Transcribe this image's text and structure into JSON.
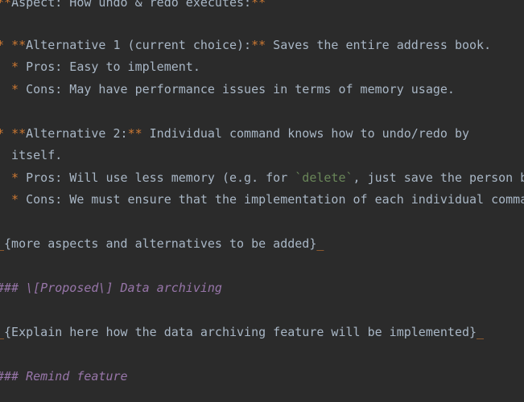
{
  "lines": [
    {
      "parts": [
        "**",
        "Aspect: How undo & redo executes:",
        "**"
      ]
    },
    {
      "parts": [
        "* ",
        "**",
        "Alternative 1 (current choice):",
        "**",
        " Saves the entire address book."
      ]
    },
    {
      "parts": [
        "  * ",
        "Pros: Easy to implement."
      ]
    },
    {
      "parts": [
        "  * ",
        "Cons: May have performance issues in terms of memory usage."
      ]
    },
    {
      "parts": [
        "* ",
        "**",
        "Alternative 2:",
        "**",
        " Individual command knows how to undo/redo by"
      ]
    },
    {
      "parts": [
        "  itself."
      ]
    },
    {
      "parts": [
        "  * ",
        "Pros: Will use less memory (e.g. for ",
        "`delete`",
        ", just save the person being deleted)."
      ]
    },
    {
      "parts": [
        "  * ",
        "Cons: We must ensure that the implementation of each individual command are correct."
      ]
    },
    {
      "parts": [
        "_",
        "{more aspects and alternatives to be added}",
        "_"
      ]
    },
    {
      "parts": [
        "### ",
        "\\[Proposed\\] Data archiving"
      ]
    },
    {
      "parts": [
        "_",
        "{Explain here how the data archiving feature will be implemented}",
        "_"
      ]
    },
    {
      "parts": [
        "### ",
        "Remind feature"
      ]
    }
  ]
}
